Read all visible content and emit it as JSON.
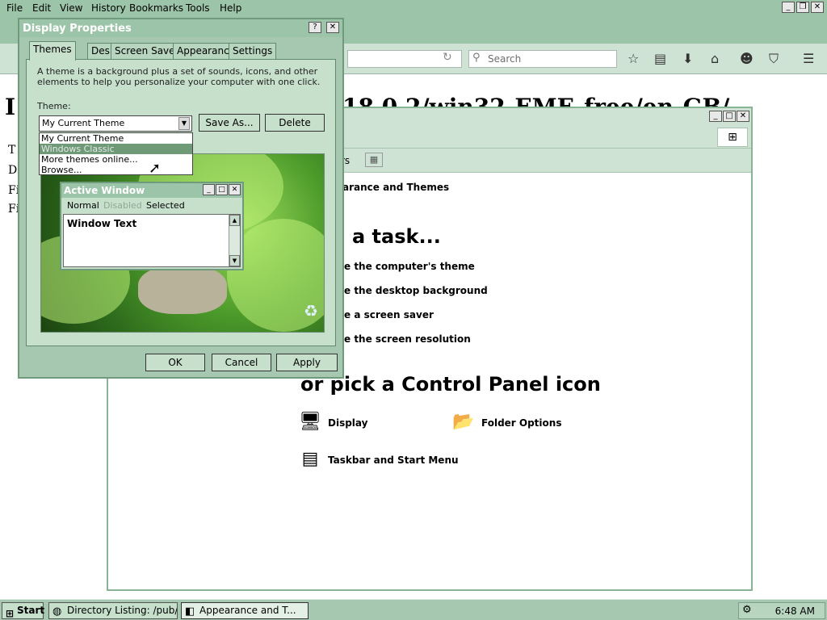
{
  "firefox": {
    "menu": [
      "File",
      "Edit",
      "View",
      "History",
      "Bookmarks",
      "Tools",
      "Help"
    ],
    "search_placeholder": "Search"
  },
  "webpage": {
    "title_fragment": "18.0.2/win32-EME-free/en-GB/",
    "title_start": "I",
    "rows": [
      "T",
      "D",
      "Fi",
      "Fi"
    ]
  },
  "control_panel": {
    "context_title": "arance and Themes",
    "pick_task": "a task...",
    "tasks": [
      "e the computer's theme",
      "e the desktop background",
      "e a screen saver",
      "e the screen resolution"
    ],
    "toolbar_fragment": "rs",
    "pick_icon": "or pick a Control Panel icon",
    "icons": [
      {
        "label": "Display",
        "icon": "display-icon"
      },
      {
        "label": "Folder Options",
        "icon": "folder-options-icon"
      },
      {
        "label": "Taskbar and Start Menu",
        "icon": "taskbar-icon"
      }
    ]
  },
  "dialog": {
    "title": "Display Properties",
    "help_btn": "?",
    "close_btn": "✕",
    "tabs": [
      "Themes",
      "Desktop",
      "Screen Saver",
      "Appearance",
      "Settings"
    ],
    "active_tab": "Themes",
    "description": "A theme is a background plus a set of sounds, icons, and other elements to help you personalize your computer with one click.",
    "theme_label": "Theme:",
    "theme_selected": "My Current Theme",
    "theme_options": [
      "My Current Theme",
      "Windows Classic",
      "More themes online...",
      "Browse..."
    ],
    "highlighted_option": "Windows Classic",
    "save_as": "Save As...",
    "delete": "Delete",
    "ok": "OK",
    "cancel": "Cancel",
    "apply": "Apply",
    "preview": {
      "window_title": "Active Window",
      "menu_normal": "Normal",
      "menu_disabled": "Disabled",
      "menu_selected": "Selected",
      "window_text": "Window Text"
    }
  },
  "taskbar": {
    "start": "Start",
    "tasks": [
      "Directory Listing: /pub/f...",
      "Appearance and T..."
    ],
    "clock": "6:48 AM"
  },
  "colors": {
    "chrome": "#9cc4a8",
    "panel": "#c6e0cc",
    "highlight": "#6e9a78"
  }
}
